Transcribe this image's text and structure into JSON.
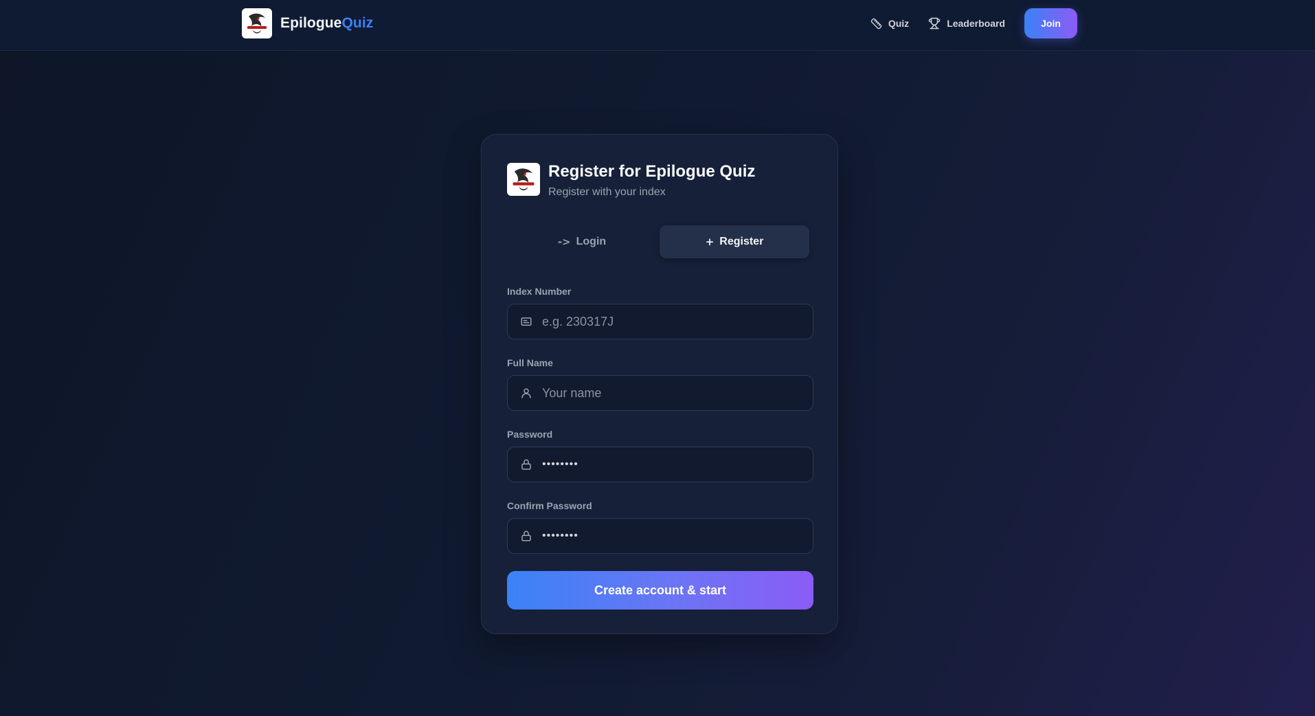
{
  "header": {
    "brand_primary": "Epilogue",
    "brand_accent": "Quiz",
    "nav": {
      "quiz_label": "Quiz",
      "leaderboard_label": "Leaderboard",
      "join_label": "Join"
    }
  },
  "card": {
    "title": "Register for Epilogue Quiz",
    "subtitle": "Register with your index",
    "tabs": [
      {
        "icon": "->",
        "label": "Login",
        "active": false
      },
      {
        "icon": "+",
        "label": "Register",
        "active": true
      }
    ],
    "fields": {
      "index": {
        "label": "Index Number",
        "placeholder": "e.g. 230317J",
        "icon": "id-card-icon"
      },
      "name": {
        "label": "Full Name",
        "placeholder": "Your name",
        "icon": "user-icon"
      },
      "password": {
        "label": "Password",
        "value": "••••••••",
        "icon": "lock-icon"
      },
      "confirm": {
        "label": "Confirm Password",
        "value": "••••••••",
        "icon": "lock-icon"
      }
    },
    "submit_label": "Create account & start"
  },
  "colors": {
    "accent_blue": "#3b82f6",
    "accent_purple": "#8b5cf6",
    "background": "#0f172a",
    "card": "#162038"
  }
}
